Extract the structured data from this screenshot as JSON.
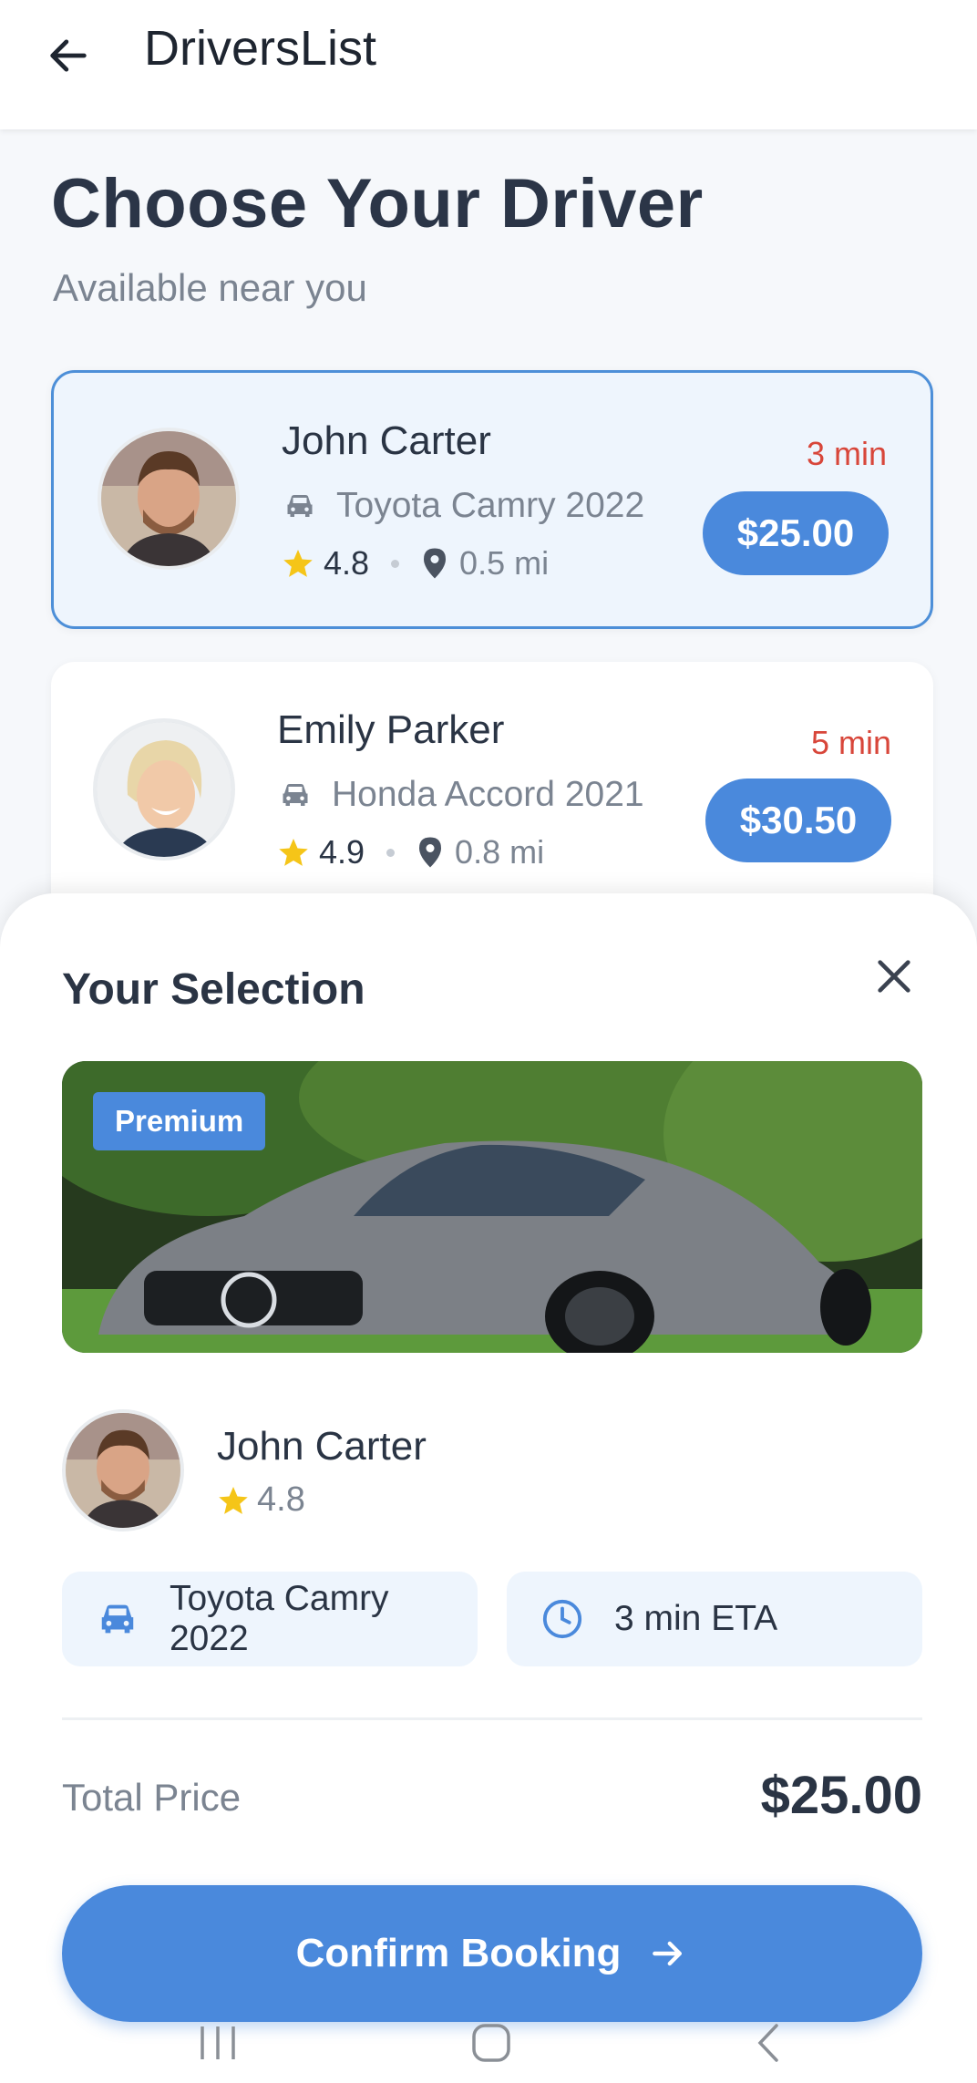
{
  "appbar": {
    "title": "DriversList"
  },
  "header": {
    "title": "Choose Your Driver",
    "subtitle": "Available near you"
  },
  "drivers": [
    {
      "name": "John Carter",
      "car": "Toyota Camry 2022",
      "rating": "4.8",
      "distance": "0.5 mi",
      "eta": "3 min",
      "price": "$25.00",
      "selected": true
    },
    {
      "name": "Emily Parker",
      "car": "Honda Accord 2021",
      "rating": "4.9",
      "distance": "0.8 mi",
      "eta": "5 min",
      "price": "$30.50",
      "selected": false
    }
  ],
  "selection": {
    "title": "Your Selection",
    "badge": "Premium",
    "driver_name": "John Carter",
    "driver_rating": "4.8",
    "car": "Toyota Camry 2022",
    "eta": "3 min ETA",
    "total_label": "Total Price",
    "total_value": "$25.00",
    "confirm_label": "Confirm Booking"
  },
  "icons": {
    "back": "arrow-left-icon",
    "car": "car-icon",
    "star": "star-icon",
    "location": "location-pin-icon",
    "close": "close-icon",
    "clock": "clock-icon",
    "arrow_right": "arrow-right-icon"
  },
  "colors": {
    "accent": "#4a89dc",
    "eta_red": "#d8463a",
    "star": "#f5c518",
    "selected_bg": "#eef5fd"
  }
}
